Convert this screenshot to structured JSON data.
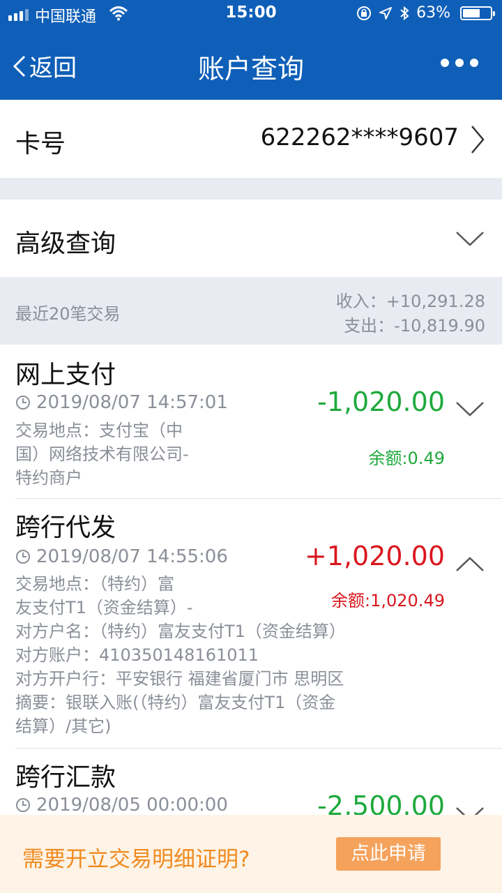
{
  "status_bar": {
    "carrier": "中国联通",
    "time": "15:00",
    "battery": "63%",
    "battery_level": 0.63
  },
  "nav": {
    "back_label": "返回",
    "title": "账户查询"
  },
  "card": {
    "label": "卡号",
    "number": "622262****9607"
  },
  "advanced": {
    "label": "高级查询"
  },
  "summary": {
    "label": "最近20笔交易",
    "income": "收入：+10,291.28",
    "expense": "支出：-10,819.90"
  },
  "transactions": [
    {
      "title": "网上支付",
      "time": "2019/08/07 14:57:01",
      "amount": "-1,020.00",
      "balance": "余额:0.49",
      "details": [
        "交易地点：支付宝（中",
        "国）网络技术有限公司-",
        "特约商户"
      ]
    },
    {
      "title": "跨行代发",
      "time": "2019/08/07 14:55:06",
      "amount": "+1,020.00",
      "balance": "余额:1,020.49",
      "details": [
        "交易地点：（特约）富",
        "友支付T1（资金结算）-",
        "对方户名：（特约）富友支付T1（资金结算）",
        "对方账户：410350148161011",
        "对方开户行：平安银行 福建省厦门市 思明区",
        "摘要：银联入账(（特约）富友支付T1（资金",
        "结算）/其它)"
      ]
    },
    {
      "title": "跨行汇款",
      "time": "2019/08/05 00:00:00",
      "amount": "-2,500.00"
    }
  ],
  "banner": {
    "text": "需要开立交易明细证明?",
    "button": "点此申请"
  },
  "colors": {
    "header_blue": "#0f5fb8",
    "expense_green": "#1ea93c",
    "income_red": "#d9161e",
    "banner_orange": "#f08a1e",
    "button_orange": "#f5a25c"
  }
}
